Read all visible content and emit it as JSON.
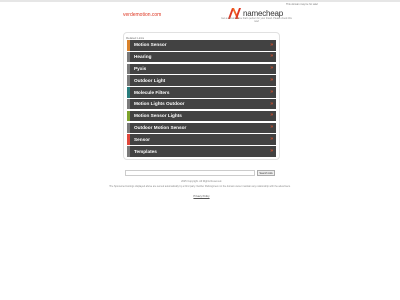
{
  "header": {
    "note": "This domain may be for sale!",
    "domain": "verdemotion.com",
    "brand_name": "namecheap",
    "pitch": "Get a domain name that's perfect for your brand. Please check this now!"
  },
  "related": {
    "title": "Related Links",
    "links": [
      {
        "label": "Motion Sensor",
        "accent": "#d9822b"
      },
      {
        "label": "Hearing",
        "accent": "#7a7a7a"
      },
      {
        "label": "Pyxis",
        "accent": "#7a7a7a"
      },
      {
        "label": "Outdoor Light",
        "accent": "#7a7a7a"
      },
      {
        "label": "Molecule Filters",
        "accent": "#2a7d7d"
      },
      {
        "label": "Motion Lights Outdoor",
        "accent": "#7a7a7a"
      },
      {
        "label": "Motion Sensor Lights",
        "accent": "#7ea32d"
      },
      {
        "label": "Outdoor Motion Sensor",
        "accent": "#7a7a7a"
      },
      {
        "label": "Sensor",
        "accent": "#e0473b"
      },
      {
        "label": "Templates",
        "accent": "#7a7a7a"
      }
    ],
    "arrow": "»"
  },
  "search": {
    "value": "",
    "button_label": "Search Ads"
  },
  "footer": {
    "copyright": "2025 Copyright. All Rights Reserved.",
    "disclaimer": "The Sponsored Listings displayed above are served automatically by a third party. Neither Parkingcrew nor the domain owner maintain any relationship with the advertisers.",
    "privacy": "Privacy Policy"
  },
  "colors": {
    "domain": "#de3723",
    "brand_orange": "#de3723",
    "panel_row": "#424242",
    "arrow": "#e7522b"
  }
}
